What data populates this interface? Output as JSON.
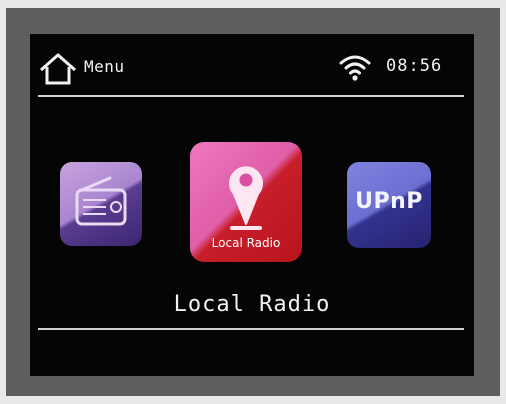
{
  "status_bar": {
    "home_icon": "home-icon",
    "menu_label": "Menu",
    "wifi_icon": "wifi-icon",
    "time": "08:56"
  },
  "carousel": {
    "items": [
      {
        "id": "radio",
        "icon": "radio-icon",
        "label": ""
      },
      {
        "id": "local-radio",
        "icon": "map-pin-icon",
        "label": "Local Radio",
        "selected": true
      },
      {
        "id": "upnp",
        "icon": "upnp-icon",
        "label": "UPnP"
      }
    ]
  },
  "selected_title": "Local Radio",
  "colors": {
    "screen_bg": "#050505",
    "text": "#f2f2f2",
    "radio_tile": "#a985cf",
    "local_radio_tile_top": "#ef77bd",
    "local_radio_tile_bottom": "#c71e2a",
    "upnp_tile": "#6c6fd1"
  }
}
